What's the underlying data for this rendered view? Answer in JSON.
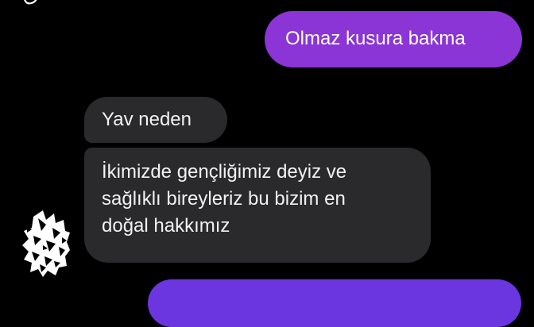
{
  "chat": {
    "messages": [
      {
        "direction": "outgoing",
        "text": "Olmaz kusura bakma"
      },
      {
        "direction": "incoming",
        "text": "Yav neden"
      },
      {
        "direction": "incoming",
        "text": "İkimizde gençliğimiz deyiz ve\nsağlıklı bireyleriz bu bizim en\ndoğal hakkımız"
      },
      {
        "direction": "outgoing",
        "text": ""
      }
    ],
    "contact": {
      "avatar_icon": "houndstooth-avatar-icon"
    }
  },
  "colors": {
    "background": "#000000",
    "outgoing_bubble": "#8b35d6",
    "outgoing_bubble_next": "#6b35e0",
    "incoming_bubble": "#2a2a2c"
  }
}
